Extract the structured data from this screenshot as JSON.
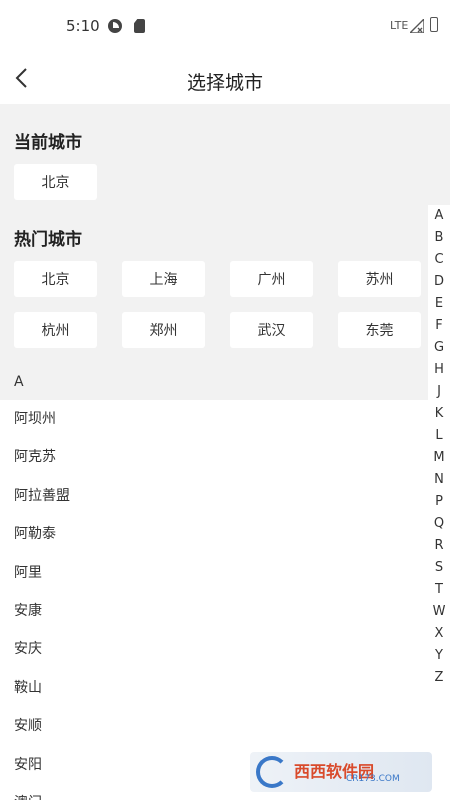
{
  "status_bar": {
    "time": "5:10",
    "network": "LTE"
  },
  "nav": {
    "back_icon": "chevron-left-icon",
    "title": "选择城市"
  },
  "current_city": {
    "title": "当前城市",
    "city": "北京"
  },
  "hot_cities": {
    "title": "热门城市",
    "cities": [
      "北京",
      "上海",
      "广州",
      "苏州",
      "杭州",
      "郑州",
      "武汉",
      "东莞"
    ]
  },
  "list": {
    "letter": "A",
    "cities": [
      "阿坝州",
      "阿克苏",
      "阿拉善盟",
      "阿勒泰",
      "阿里",
      "安康",
      "安庆",
      "鞍山",
      "安顺",
      "安阳",
      "澳门"
    ]
  },
  "index_letters": [
    "A",
    "B",
    "C",
    "D",
    "E",
    "F",
    "G",
    "H",
    "J",
    "K",
    "L",
    "M",
    "N",
    "P",
    "Q",
    "R",
    "S",
    "T",
    "W",
    "X",
    "Y",
    "Z"
  ],
  "watermark": {
    "brand": "西西软件园",
    "sub": "CR173.COM"
  },
  "colors": {
    "panel_bg": "#f2f2f2",
    "chip_bg": "#ffffff",
    "text": "#333333"
  }
}
